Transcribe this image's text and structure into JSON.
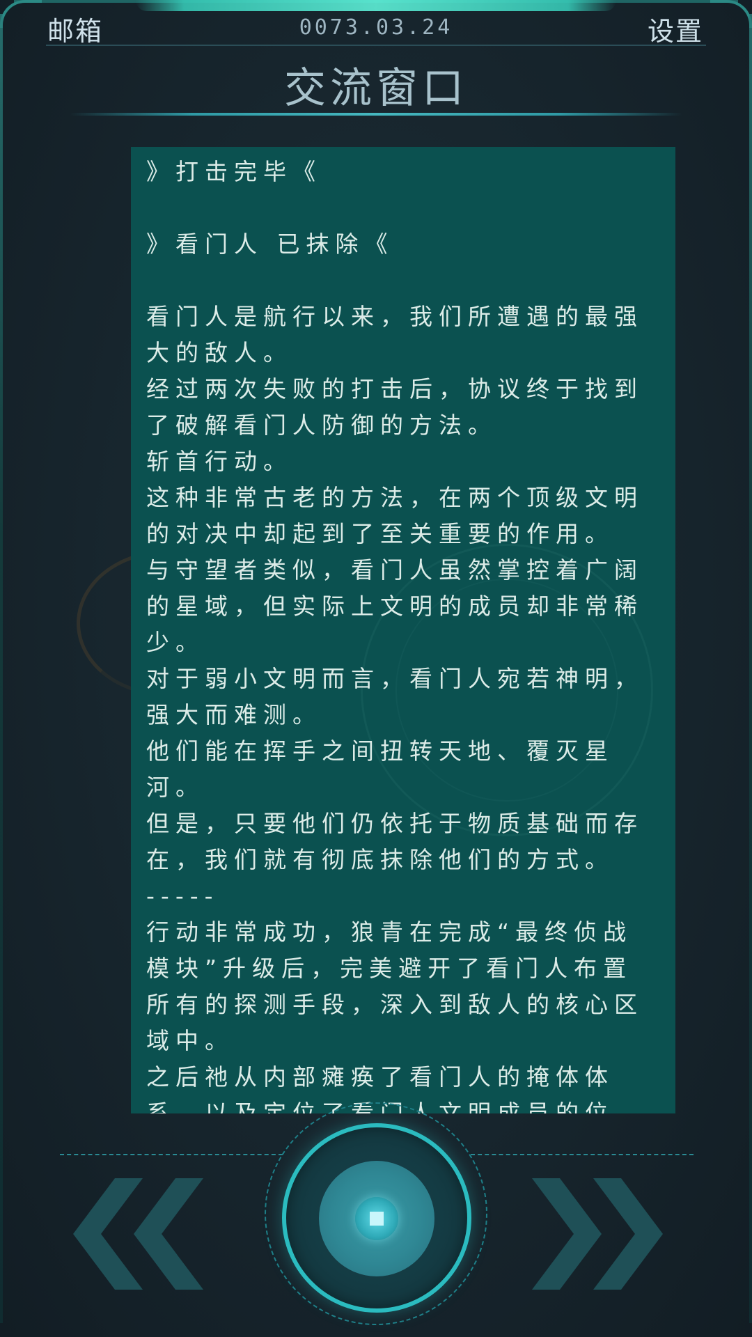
{
  "header": {
    "mail_label": "邮箱",
    "date": "0073.03.24",
    "settings_label": "设置",
    "title": "交流窗口"
  },
  "message": {
    "lines": [
      "》打击完毕《",
      "",
      "》看门人 已抹除《",
      "",
      "看门人是航行以来，我们所遭遇的最强大的敌人。",
      "经过两次失败的打击后，协议终于找到了破解看门人防御的方法。",
      "斩首行动。",
      "这种非常古老的方法，在两个顶级文明的对决中却起到了至关重要的作用。",
      "与守望者类似，看门人虽然掌控着广阔的星域，但实际上文明的成员却非常稀少。",
      "对于弱小文明而言，看门人宛若神明，强大而难测。",
      "他们能在挥手之间扭转天地、覆灭星河。",
      "但是，只要他们仍依托于物质基础而存在，我们就有彻底抹除他们的方式。",
      "-----",
      "行动非常成功，狼青在完成“最终侦战模块”升级后，完美避开了看门人布置所有的探测手段，深入到敌人的核心区域中。",
      "之后祂从内部瘫痪了看门人的掩体体系，以及定位了看门人文明成员的位置，"
    ]
  },
  "controls": {
    "prev_icon": "double-chevron-left-icon",
    "next_icon": "double-chevron-right-icon",
    "center_icon": "circular-confirm-icon"
  },
  "colors": {
    "background": "#16222a",
    "panel": "#0b5150",
    "accent": "#2bbcc0",
    "text": "#dcece8"
  }
}
